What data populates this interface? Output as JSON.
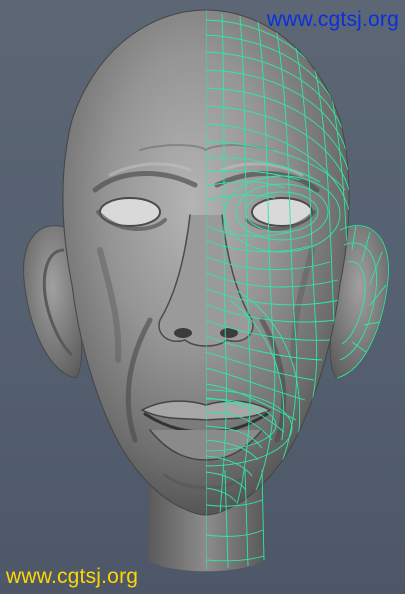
{
  "scene": {
    "subject_icon": "sculpted-head-render-icon",
    "background_color": "#576273",
    "wireframe_color": "#2fe8a4",
    "surface_color": "#8a8a8a"
  },
  "watermarks": {
    "top_text": "www.cgtsj.org",
    "top_color": "#0a2fe0",
    "bottom_text": "www.cgtsj.org",
    "bottom_color": "#ffd700"
  }
}
